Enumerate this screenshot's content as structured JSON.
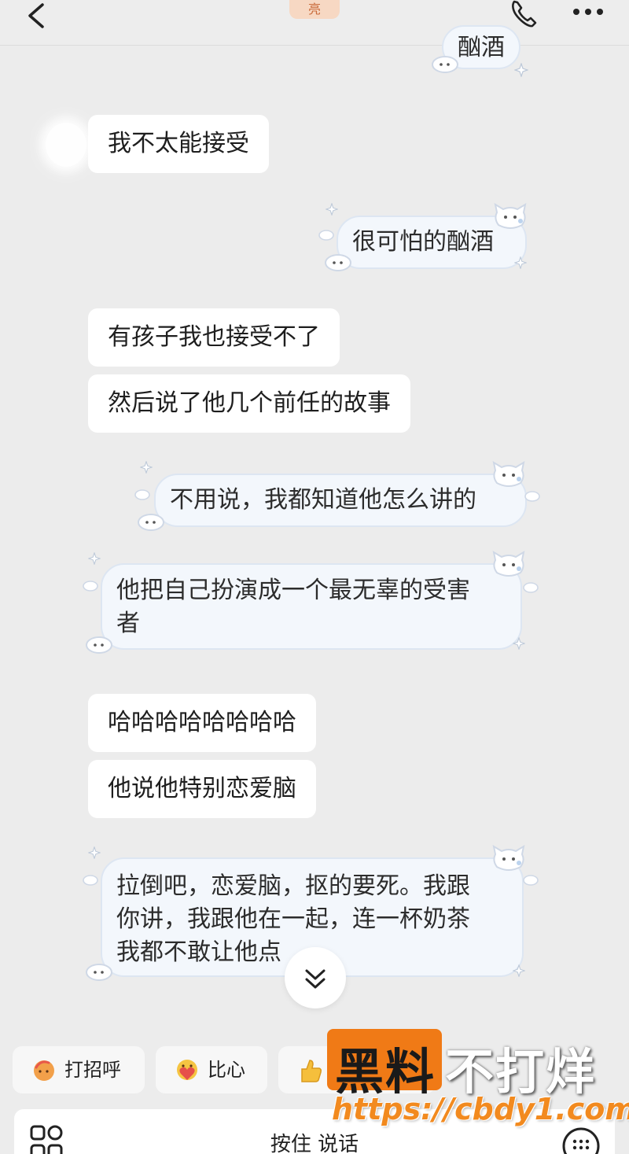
{
  "header": {
    "badge_text": "亮",
    "back_icon": "chevron-left-icon",
    "call_icon": "phone-icon",
    "menu_icon": "more-horizontal-icon"
  },
  "messages": [
    {
      "side": "right",
      "text": "酗酒",
      "partial": true
    },
    {
      "side": "left",
      "text": "我不太能接受"
    },
    {
      "side": "right",
      "text": "很可怕的酗酒"
    },
    {
      "side": "left",
      "text": "有孩子我也接受不了"
    },
    {
      "side": "left",
      "text": "然后说了他几个前任的故事"
    },
    {
      "side": "right",
      "text": "不用说，我都知道他怎么讲的"
    },
    {
      "side": "right",
      "lines": [
        "他把自己扮演成一个最无辜的受害",
        "者"
      ]
    },
    {
      "side": "left",
      "text": "哈哈哈哈哈哈哈哈"
    },
    {
      "side": "left",
      "text": "他说他特别恋爱脑"
    },
    {
      "side": "right",
      "lines": [
        "拉倒吧，恋爱脑，抠的要死。我跟",
        "你讲，我跟他在一起，连一杯奶茶",
        "我都不敢让他点"
      ]
    }
  ],
  "scroll_button_icon": "double-chevron-down-icon",
  "quick_replies": [
    {
      "label": "打招呼",
      "icon": "wave-hand-icon"
    },
    {
      "label": "比心",
      "icon": "heart-hands-icon"
    },
    {
      "label": "",
      "icon": "thumbs-up-icon"
    }
  ],
  "input_bar": {
    "hold_to_talk": "按住 说话",
    "left_icon": "apps-grid-icon",
    "right_icon": "keyboard-icon"
  },
  "watermark": {
    "brand_orange": "黑料",
    "brand_white": "不打烊",
    "url": "https://cbdy1.com",
    "accent_color": "#f07a16"
  },
  "colors": {
    "background": "#ececec",
    "left_bubble": "#ffffff",
    "right_bubble": "#f3f7fc",
    "right_bubble_border": "#dde6f2"
  }
}
